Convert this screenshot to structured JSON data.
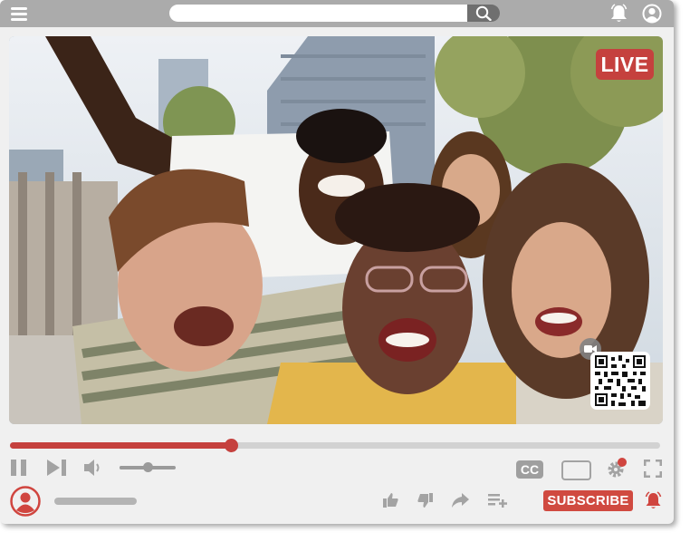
{
  "header": {
    "search": {
      "placeholder": ""
    },
    "icons": [
      "menu-icon",
      "search-icon",
      "notification-bell-icon",
      "account-circle-icon"
    ]
  },
  "video": {
    "live_label": "LIVE",
    "thumbnail": "Five friends laughing together outdoors, taking a selfie",
    "overlay_icons": [
      "video-camera-icon",
      "qr-code"
    ]
  },
  "player": {
    "progress": 0.34,
    "volume": 0.5,
    "controls": [
      "pause-icon",
      "skip-next-icon",
      "volume-icon",
      "settings-gear-icon",
      "fullscreen-icon"
    ],
    "cc_label": "CC"
  },
  "channel": {
    "subscribe_label": "SUBSCRIBE",
    "actions": [
      "like-icon",
      "dislike-icon",
      "share-icon",
      "add-to-playlist-icon",
      "notification-bell-icon"
    ]
  },
  "colors": {
    "accent": "#c5413e",
    "topbar": "#ababab",
    "icon_gray": "#a3a3a3"
  }
}
